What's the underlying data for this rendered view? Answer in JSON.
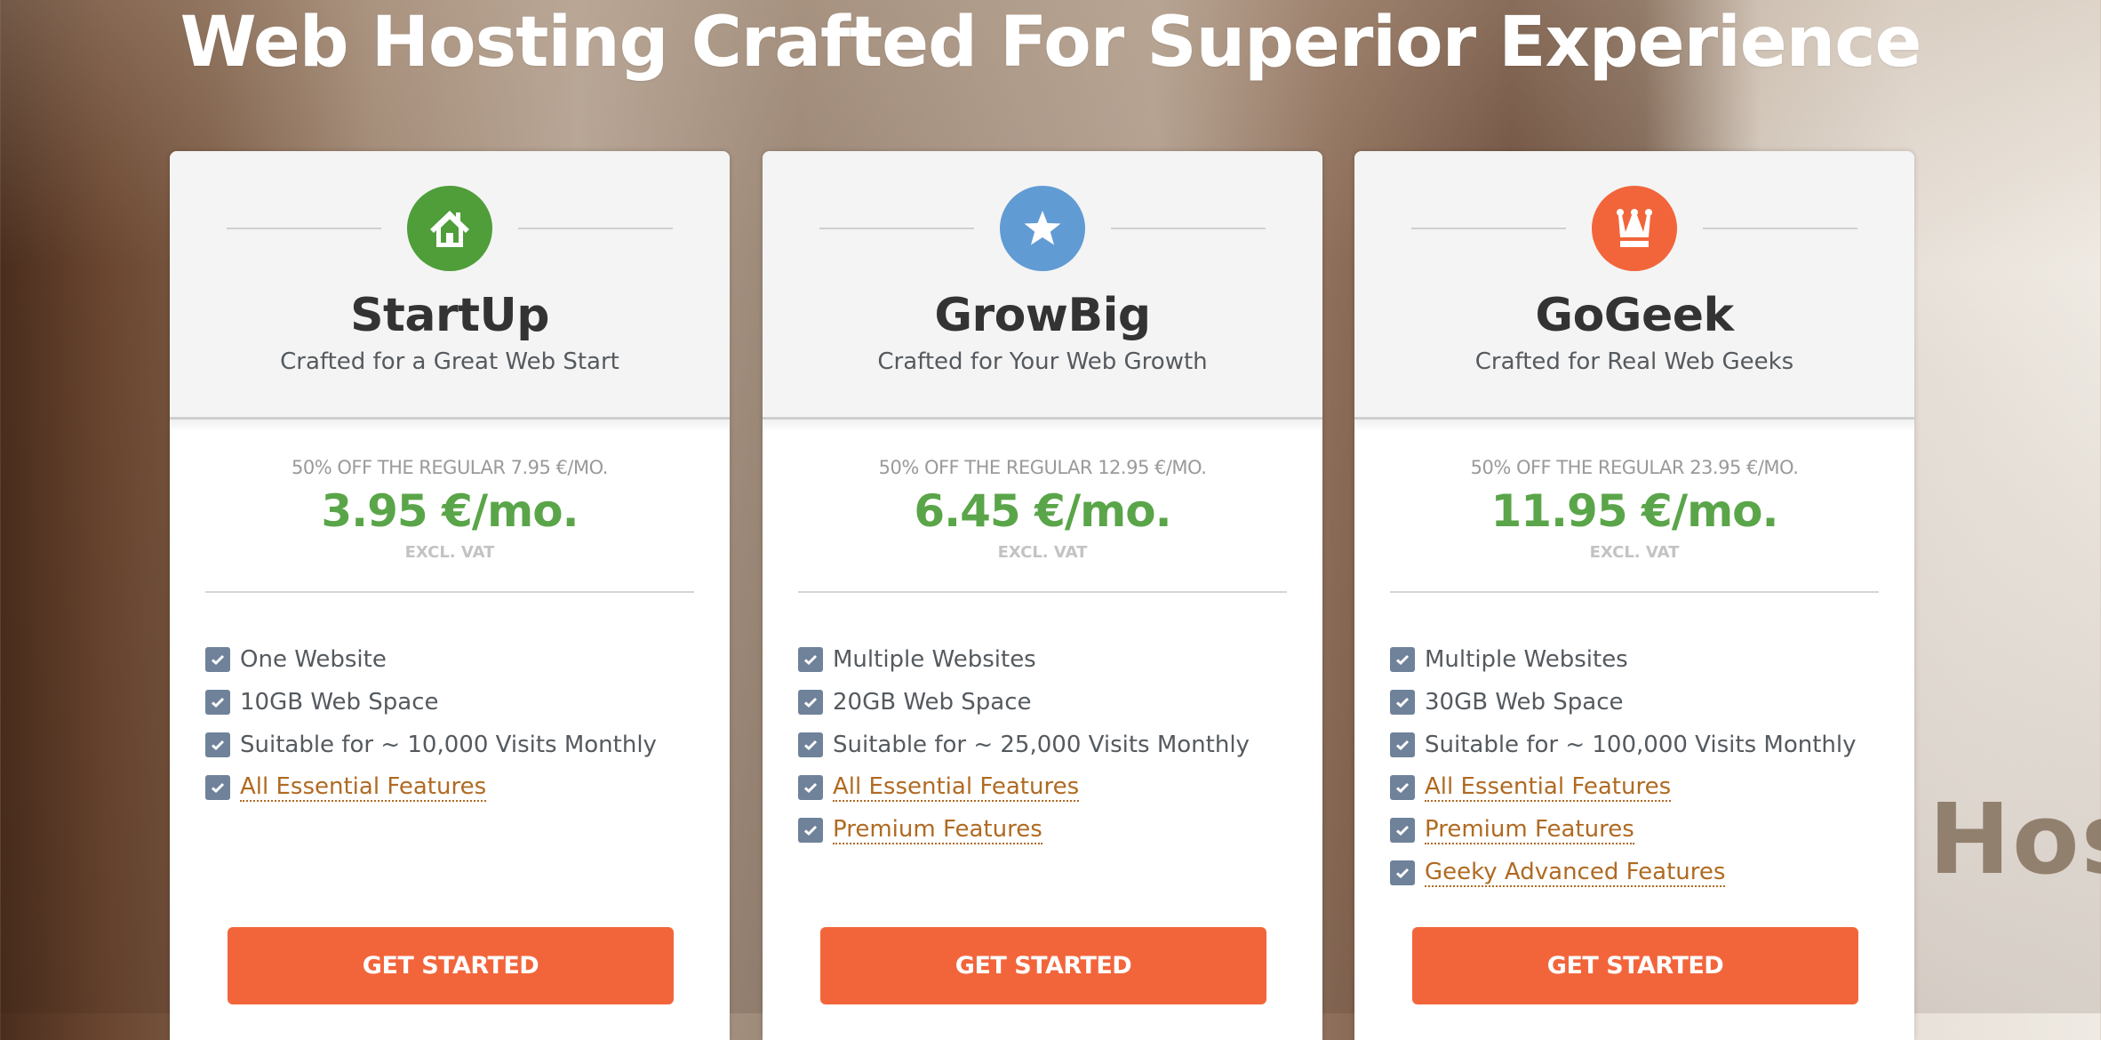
{
  "page": {
    "title": "Web Hosting Crafted For Superior Experience",
    "background_word": "Hos"
  },
  "colors": {
    "price_green": "#5aa549",
    "button_orange": "#f2653b",
    "link_brown": "#b06a22",
    "checkbox_slate": "#6f8299"
  },
  "plans": [
    {
      "name": "StartUp",
      "tagline": "Crafted for a Great Web Start",
      "icon": "house-icon",
      "icon_color": "#4f9e3a",
      "discount": "50% OFF THE REGULAR 7.95 €/MO.",
      "price": "3.95 €/mo.",
      "vat": "EXCL. VAT",
      "features": [
        {
          "label": "One Website",
          "link": false
        },
        {
          "label": "10GB Web Space",
          "link": false
        },
        {
          "label": "Suitable for ~ 10,000 Visits Monthly",
          "link": false
        },
        {
          "label": "All Essential Features",
          "link": true
        }
      ],
      "button": "GET STARTED"
    },
    {
      "name": "GrowBig",
      "tagline": "Crafted for Your Web Growth",
      "icon": "star-icon",
      "icon_color": "#619bd4",
      "discount": "50% OFF THE REGULAR 12.95 €/MO.",
      "price": "6.45 €/mo.",
      "vat": "EXCL. VAT",
      "features": [
        {
          "label": "Multiple Websites",
          "link": false
        },
        {
          "label": "20GB Web Space",
          "link": false
        },
        {
          "label": "Suitable for ~ 25,000 Visits Monthly",
          "link": false
        },
        {
          "label": "All Essential Features",
          "link": true
        },
        {
          "label": "Premium Features",
          "link": true
        }
      ],
      "button": "GET STARTED"
    },
    {
      "name": "GoGeek",
      "tagline": "Crafted for Real Web Geeks",
      "icon": "crown-icon",
      "icon_color": "#f2653b",
      "discount": "50% OFF THE REGULAR 23.95 €/MO.",
      "price": "11.95 €/mo.",
      "vat": "EXCL. VAT",
      "features": [
        {
          "label": "Multiple Websites",
          "link": false
        },
        {
          "label": "30GB Web Space",
          "link": false
        },
        {
          "label": "Suitable for ~ 100,000 Visits Monthly",
          "link": false
        },
        {
          "label": "All Essential Features",
          "link": true
        },
        {
          "label": "Premium Features",
          "link": true
        },
        {
          "label": "Geeky Advanced Features",
          "link": true
        }
      ],
      "button": "GET STARTED"
    }
  ]
}
